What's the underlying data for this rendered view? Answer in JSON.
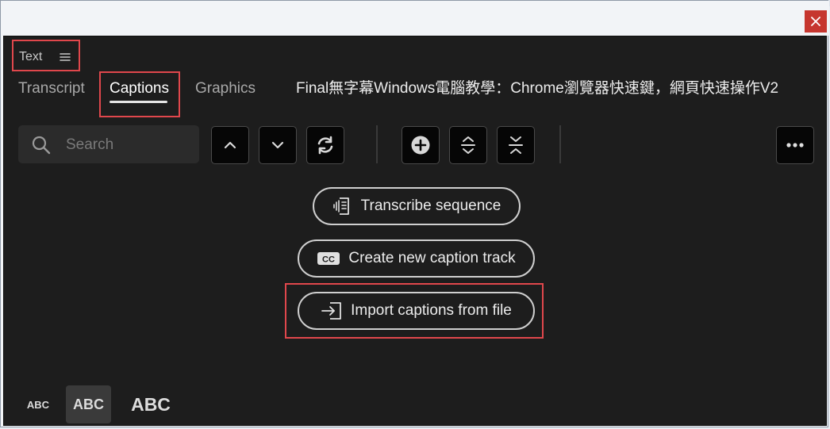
{
  "window": {
    "close_icon": "close-icon"
  },
  "panel": {
    "title": "Text",
    "menu_icon": "hamburger-menu-icon"
  },
  "tabs": [
    {
      "label": "Transcript",
      "active": false
    },
    {
      "label": "Captions",
      "active": true
    },
    {
      "label": "Graphics",
      "active": false
    }
  ],
  "document_title": "Final無字幕Windows電腦教學：Chrome瀏覽器快速鍵，網頁快速操作V2",
  "search": {
    "placeholder": "Search",
    "value": ""
  },
  "toolbar": {
    "icons": [
      "chevron-up-icon",
      "chevron-down-icon",
      "refresh-icon",
      "add-circle-icon",
      "expand-vertical-icon",
      "collapse-vertical-icon",
      "more-icon"
    ]
  },
  "actions": {
    "transcribe_label": "Transcribe sequence",
    "create_track_label": "Create new caption track",
    "import_label": "Import captions from file"
  },
  "text_sizes": [
    {
      "label": "ABC",
      "selected": false
    },
    {
      "label": "ABC",
      "selected": true
    },
    {
      "label": "ABC",
      "selected": false
    }
  ],
  "colors": {
    "panel_bg": "#1d1d1d",
    "highlight": "#e0474c",
    "close_button": "#c6362f"
  }
}
